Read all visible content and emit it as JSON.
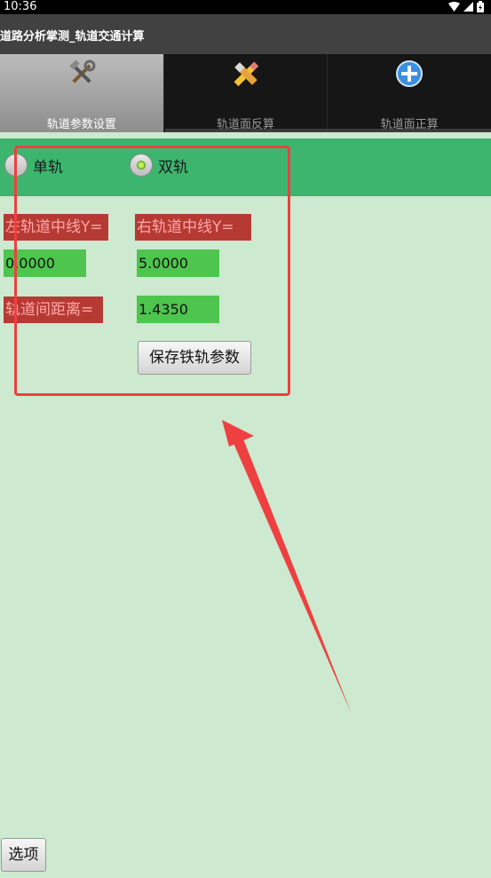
{
  "statusbar": {
    "time": "10:36"
  },
  "app": {
    "title": "道路分析掌测_轨道交通计算"
  },
  "tabs": [
    {
      "label": "轨道参数设置",
      "icon": "tools-icon",
      "selected": true
    },
    {
      "label": "轨道面反算",
      "icon": "pencil-eraser-icon",
      "selected": false
    },
    {
      "label": "轨道面正算",
      "icon": "plus-circle-icon",
      "selected": false
    }
  ],
  "radios": {
    "single": {
      "label": "单轨",
      "checked": false
    },
    "double": {
      "label": "双轨",
      "checked": true
    }
  },
  "form": {
    "left_label": "左轨道中线Y=",
    "left_value": "0.0000",
    "right_label": "右轨道中线Y=",
    "right_value": "5.0000",
    "gauge_label": "轨道间距离=",
    "gauge_value": "1.4350",
    "save_button": "保存铁轨参数"
  },
  "footer": {
    "options_button": "选项"
  },
  "colors": {
    "accent_green": "#3db56f",
    "label_red": "#b63a34",
    "field_green": "#4ec54e",
    "annotation_red": "#ee4040"
  }
}
